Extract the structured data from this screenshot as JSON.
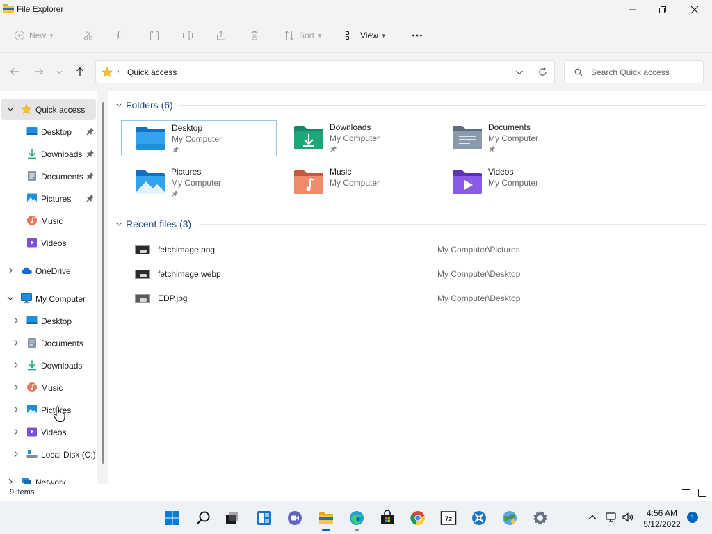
{
  "window": {
    "title": "File Explorer"
  },
  "toolbar": {
    "new_label": "New",
    "sort_label": "Sort",
    "view_label": "View"
  },
  "address": {
    "current": "Quick access"
  },
  "search": {
    "placeholder": "Search Quick access"
  },
  "sidebar": {
    "quick_access": {
      "label": "Quick access",
      "items": [
        {
          "label": "Desktop",
          "icon": "desktop-icon",
          "pinned": true
        },
        {
          "label": "Downloads",
          "icon": "download-icon",
          "pinned": true
        },
        {
          "label": "Documents",
          "icon": "documents-icon",
          "pinned": true
        },
        {
          "label": "Pictures",
          "icon": "pictures-icon",
          "pinned": true
        },
        {
          "label": "Music",
          "icon": "music-icon",
          "pinned": false
        },
        {
          "label": "Videos",
          "icon": "videos-icon",
          "pinned": false
        }
      ]
    },
    "onedrive": {
      "label": "OneDrive"
    },
    "my_computer": {
      "label": "My Computer",
      "items": [
        {
          "label": "Desktop",
          "icon": "desktop-icon"
        },
        {
          "label": "Documents",
          "icon": "documents-icon"
        },
        {
          "label": "Downloads",
          "icon": "download-icon"
        },
        {
          "label": "Music",
          "icon": "music-icon"
        },
        {
          "label": "Pictures",
          "icon": "pictures-icon"
        },
        {
          "label": "Videos",
          "icon": "videos-icon"
        },
        {
          "label": "Local Disk (C:)",
          "icon": "drive-icon"
        }
      ]
    },
    "network": {
      "label": "Network"
    }
  },
  "folders": {
    "header": "Folders (6)",
    "items": [
      {
        "name": "Desktop",
        "location": "My Computer",
        "icon": "desktop-folder-icon",
        "pinned": true
      },
      {
        "name": "Downloads",
        "location": "My Computer",
        "icon": "downloads-folder-icon",
        "pinned": true
      },
      {
        "name": "Documents",
        "location": "My Computer",
        "icon": "documents-folder-icon",
        "pinned": true
      },
      {
        "name": "Pictures",
        "location": "My Computer",
        "icon": "pictures-folder-icon",
        "pinned": true
      },
      {
        "name": "Music",
        "location": "My Computer",
        "icon": "music-folder-icon",
        "pinned": false
      },
      {
        "name": "Videos",
        "location": "My Computer",
        "icon": "videos-folder-icon",
        "pinned": false
      }
    ]
  },
  "recent": {
    "header": "Recent files (3)",
    "files": [
      {
        "name": "fetchimage.png",
        "path": "My Computer\\Pictures"
      },
      {
        "name": "fetchimage.webp",
        "path": "My Computer\\Desktop"
      },
      {
        "name": "EDP.jpg",
        "path": "My Computer\\Desktop"
      }
    ]
  },
  "status": {
    "item_count": "9 items"
  },
  "taskbar": {
    "time": "4:56 AM",
    "date": "5/12/2022",
    "notification_count": "1",
    "apps": [
      "start-icon",
      "search-icon",
      "task-view-icon",
      "widgets-icon",
      "chat-icon",
      "file-explorer-icon",
      "edge-icon",
      "store-icon",
      "chrome-icon",
      "7zip-icon",
      "app-icon",
      "network-app-icon",
      "settings-icon"
    ]
  },
  "colors": {
    "accent": "#0067c0",
    "selection_border": "#99c7ee",
    "section_header": "#1f4a7c",
    "folder_blue": "#1e8fd8",
    "folder_green": "#1ba77a",
    "folder_gray": "#7c8a9c",
    "folder_orange": "#e8785a",
    "folder_purple": "#7b4fd6"
  }
}
